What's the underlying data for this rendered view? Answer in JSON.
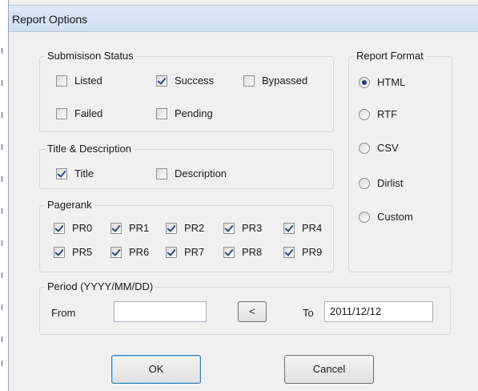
{
  "window": {
    "title": "Report Options"
  },
  "submission_status": {
    "legend": "Submisison Status",
    "options": [
      {
        "label": "Listed",
        "checked": false
      },
      {
        "label": "Success",
        "checked": true
      },
      {
        "label": "Bypassed",
        "checked": false
      },
      {
        "label": "Failed",
        "checked": false
      },
      {
        "label": "Pending",
        "checked": false
      }
    ]
  },
  "title_description": {
    "legend": "Title & Description",
    "options": [
      {
        "label": "Title",
        "checked": true
      },
      {
        "label": "Description",
        "checked": false
      }
    ]
  },
  "pagerank": {
    "legend": "Pagerank",
    "options": [
      {
        "label": "PR0",
        "checked": true
      },
      {
        "label": "PR1",
        "checked": true
      },
      {
        "label": "PR2",
        "checked": true
      },
      {
        "label": "PR3",
        "checked": true
      },
      {
        "label": "PR4",
        "checked": true
      },
      {
        "label": "PR5",
        "checked": true
      },
      {
        "label": "PR6",
        "checked": true
      },
      {
        "label": "PR7",
        "checked": true
      },
      {
        "label": "PR8",
        "checked": true
      },
      {
        "label": "PR9",
        "checked": true
      }
    ]
  },
  "report_format": {
    "legend": "Report Format",
    "options": [
      {
        "label": "HTML",
        "selected": true
      },
      {
        "label": "RTF",
        "selected": false
      },
      {
        "label": "CSV",
        "selected": false
      },
      {
        "label": "Dirlist",
        "selected": false
      },
      {
        "label": "Custom",
        "selected": false
      }
    ]
  },
  "period": {
    "legend": "Period (YYYY/MM/DD)",
    "from_label": "From",
    "from_value": "",
    "prev_button": "<",
    "to_label": "To",
    "to_value": "2011/12/12"
  },
  "buttons": {
    "ok": "OK",
    "cancel": "Cancel"
  }
}
